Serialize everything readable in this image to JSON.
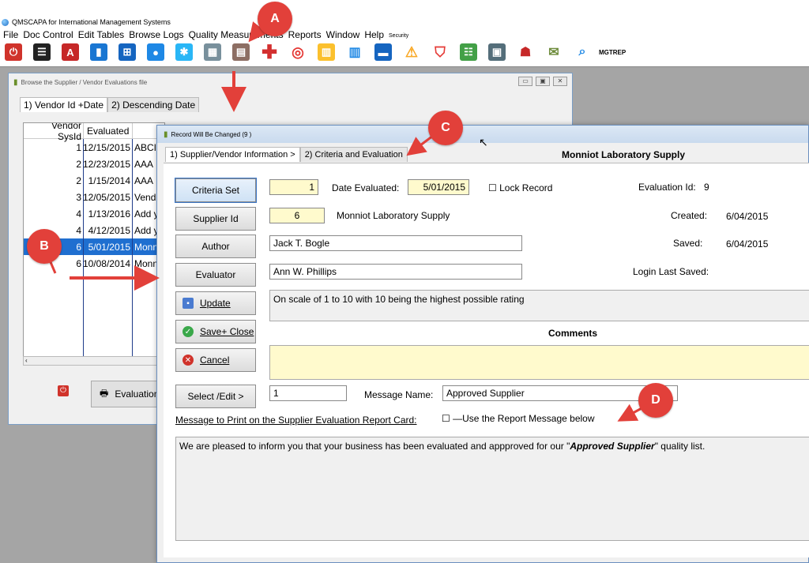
{
  "app": {
    "title": "QMSCAPA for International Management Systems",
    "menu": [
      "File",
      "Doc Control",
      "Edit Tables",
      "Browse Logs",
      "Quality Measurements",
      "Reports",
      "Window",
      "Help"
    ],
    "menu_small": "Security",
    "toolbar_label": "MGTREP"
  },
  "browse": {
    "title": "Browse the Supplier / Vendor Evaluations file",
    "tabs": [
      "1) Vendor Id +Date",
      "2) Descending Date"
    ],
    "headers": [
      "Vendor SysId",
      "Evaluated"
    ],
    "rows": [
      {
        "id": "1",
        "date": "12/15/2015",
        "text": "ABCI"
      },
      {
        "id": "2",
        "date": "12/23/2015",
        "text": "AAA"
      },
      {
        "id": "2",
        "date": "1/15/2014",
        "text": "AAA"
      },
      {
        "id": "3",
        "date": "12/05/2015",
        "text": "Vend"
      },
      {
        "id": "4",
        "date": "1/13/2016",
        "text": "Add y"
      },
      {
        "id": "4",
        "date": "4/12/2015",
        "text": "Add y"
      },
      {
        "id": "6",
        "date": "5/01/2015",
        "text": "Monn"
      },
      {
        "id": "6",
        "date": "10/08/2014",
        "text": "Monn"
      }
    ],
    "eval_button": "Evaluation"
  },
  "dialog": {
    "title": "Record Will Be Changed  (9         )",
    "tabs": [
      "1) Supplier/Vendor Information >",
      "2) Criteria and Evaluation"
    ],
    "heading": "Monniot Laboratory Supply",
    "buttons": {
      "criteria_set": "Criteria Set",
      "supplier_id": "Supplier Id",
      "author": "Author",
      "evaluator": "Evaluator",
      "update": "Update",
      "save_close": "Save+ Close",
      "cancel": "Cancel",
      "select_edit": "Select /Edit >"
    },
    "criteria_set_value": "1",
    "date_evaluated_label": "Date Evaluated:",
    "date_evaluated_value": "5/01/2015",
    "lock_record_label": "Lock Record",
    "evaluation_id_label": "Evaluation Id:",
    "evaluation_id_value": "9",
    "supplier_id_value": "6",
    "supplier_name": "Monniot Laboratory Supply",
    "created_label": "Created:",
    "created_value": "6/04/2015",
    "saved_label": "Saved:",
    "saved_value": "6/04/2015",
    "author_value": "Jack T. Bogle",
    "evaluator_value": "Ann W. Phillips",
    "login_last_saved_label": "Login Last Saved:",
    "scale_note": "On scale of 1 to 10 with 10 being the highest possible rating",
    "comments_label": "Comments",
    "message_id": "1",
    "message_name_label": "Message Name:",
    "message_name_value": "Approved Supplier",
    "print_message_label": "Message to Print on the Supplier Evaluation Report Card:",
    "use_report_message_label": "—Use the Report Message below",
    "message_text_prefix": "We are pleased to inform you that your business has been evaluated and appproved for our \"",
    "message_text_bold": "Approved Supplier",
    "message_text_suffix": "\" quality list."
  },
  "callouts": [
    "A",
    "B",
    "C",
    "D"
  ],
  "colors": {
    "callout": "#e2403a",
    "selection": "#1f6fd0",
    "yellow_field": "#fffacd"
  }
}
